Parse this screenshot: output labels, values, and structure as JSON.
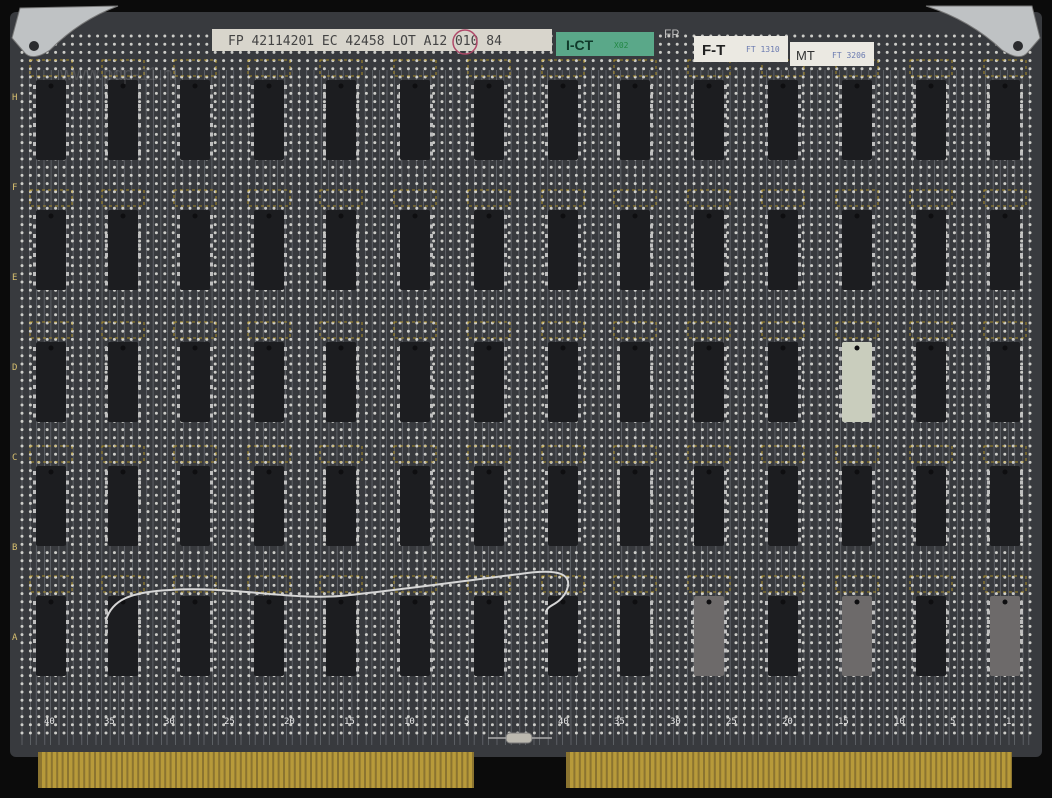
{
  "labels": {
    "main": "FP  42114201  EC 42458 LOT A12 010 84",
    "ict": "I-CT",
    "ict_stamp": "X02",
    "fp": "FP",
    "ft": "F-T",
    "ft_stamp": "FT 1310",
    "mt": "MT",
    "mt_stamp": "FT 3206",
    "watermark": "www.pdp-11.nl"
  },
  "edge_numbers_left": [
    "40",
    "35",
    "30",
    "25",
    "20",
    "15",
    "10",
    "5"
  ],
  "edge_numbers_right": [
    "40",
    "35",
    "30",
    "25",
    "20",
    "15",
    "10",
    "5",
    "1"
  ],
  "row_marks": [
    "A",
    "B",
    "C",
    "D",
    "E",
    "F",
    "H"
  ],
  "chip_rows": 5,
  "chip_cols": 14,
  "colors": {
    "board": "#383a3e",
    "trace": "#8a8e96",
    "hole": "#e6e6e0",
    "chip": "#1c1d20",
    "silk": "#c9a420",
    "gold": "#b79a3a"
  }
}
